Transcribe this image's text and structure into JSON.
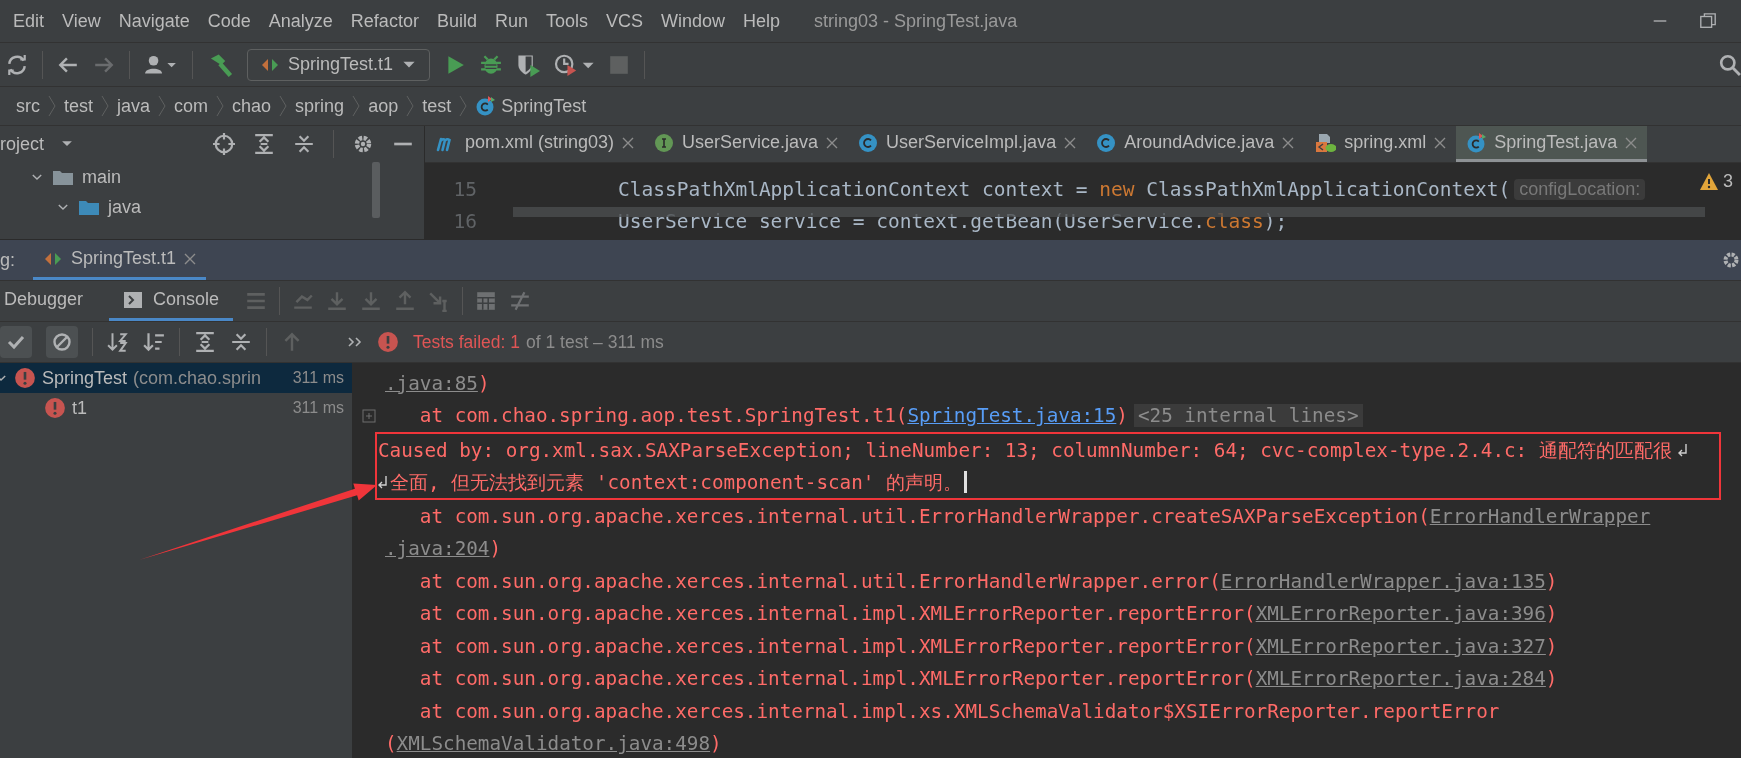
{
  "menu": [
    "Edit",
    "View",
    "Navigate",
    "Code",
    "Analyze",
    "Refactor",
    "Build",
    "Run",
    "Tools",
    "VCS",
    "Window",
    "Help"
  ],
  "window_title": "string03 - SpringTest.java",
  "run_config": "SpringTest.t1",
  "breadcrumbs": [
    {
      "label": "src",
      "kind": "plain"
    },
    {
      "label": "test",
      "kind": "plain"
    },
    {
      "label": "java",
      "kind": "plain"
    },
    {
      "label": "com",
      "kind": "plain"
    },
    {
      "label": "chao",
      "kind": "plain"
    },
    {
      "label": "spring",
      "kind": "plain"
    },
    {
      "label": "aop",
      "kind": "plain"
    },
    {
      "label": "test",
      "kind": "plain"
    },
    {
      "label": "SpringTest",
      "kind": "test_class"
    }
  ],
  "project_pane": {
    "title": "roject",
    "tree": [
      {
        "label": "main",
        "kind": "folder",
        "expanded": true,
        "children": [
          {
            "label": "java",
            "kind": "source_folder",
            "expanded": true
          }
        ]
      }
    ]
  },
  "editor_tabs": [
    {
      "label": "pom.xml (string03)",
      "kind": "maven",
      "selected": false
    },
    {
      "label": "UserService.java",
      "kind": "interface",
      "selected": false
    },
    {
      "label": "UserServiceImpl.java",
      "kind": "class",
      "selected": false
    },
    {
      "label": "AroundAdvice.java",
      "kind": "class",
      "selected": false
    },
    {
      "label": "spring.xml",
      "kind": "xml",
      "selected": false
    },
    {
      "label": "SpringTest.java",
      "kind": "test_class",
      "selected": true
    }
  ],
  "editor": {
    "warnings": "3",
    "lines": [
      {
        "number": "15",
        "tokens": [
          {
            "kind": "plain",
            "text": "ClassPathXmlApplicationContext context = "
          },
          {
            "kind": "keyword",
            "text": "new"
          },
          {
            "kind": "plain",
            "text": " ClassPathXmlApplicationContext("
          },
          {
            "kind": "hint",
            "text": "configLocation:"
          }
        ]
      },
      {
        "number": "16",
        "tokens": [
          {
            "kind": "plain",
            "text": "UserService service = context.getBean(UserService."
          },
          {
            "kind": "keyword",
            "text": "class"
          },
          {
            "kind": "plain",
            "text": ");"
          }
        ]
      }
    ]
  },
  "debug": {
    "label": "g:",
    "tabs": [
      {
        "label": "SpringTest.t1",
        "selected": true
      }
    ],
    "subtabs": [
      {
        "label": "Debugger",
        "selected": false
      },
      {
        "label": "Console",
        "selected": true
      }
    ]
  },
  "test_status": {
    "failed": "Tests failed: 1",
    "summary": "of 1 test – 311 ms"
  },
  "test_tree": [
    {
      "name": "SpringTest",
      "detail": "(com.chao.sprin",
      "time": "311 ms",
      "selected": true,
      "expanded": true,
      "children": [
        {
          "name": "t1",
          "time": "311 ms",
          "selected": false
        }
      ]
    }
  ],
  "console": [
    {
      "parts": [
        {
          "kind": "link",
          "text": ".java:85"
        },
        {
          "kind": "text",
          "text": ")"
        }
      ]
    },
    {
      "parts": [
        {
          "kind": "text",
          "text": "   at com.chao.spring.aop.test.SpringTest.t1("
        },
        {
          "kind": "source_link",
          "text": "SpringTest.java:15"
        },
        {
          "kind": "text",
          "text": ")"
        }
      ],
      "fold": "<25 internal lines>"
    },
    {
      "highlighted": true,
      "wrap_end": true,
      "parts": [
        {
          "kind": "text",
          "text": "Caused by: org.xml.sax.SAXParseException; lineNumber: 13; columnNumber: 64; cvc-complex-type.2.4.c: 通配符的匹配很"
        }
      ]
    },
    {
      "highlighted": true,
      "wrap_start": true,
      "cursor": true,
      "parts": [
        {
          "kind": "text",
          "text": "全面, 但无法找到元素 'context:component-scan' 的声明。"
        }
      ]
    },
    {
      "parts": [
        {
          "kind": "text",
          "text": "   at com.sun.org.apache.xerces.internal.util.ErrorHandlerWrapper.createSAXParseException("
        },
        {
          "kind": "link",
          "text": "ErrorHandlerWrapper"
        }
      ]
    },
    {
      "parts": [
        {
          "kind": "link",
          "text": ".java:204"
        },
        {
          "kind": "text",
          "text": ")"
        }
      ]
    },
    {
      "parts": [
        {
          "kind": "text",
          "text": "   at com.sun.org.apache.xerces.internal.util.ErrorHandlerWrapper.error("
        },
        {
          "kind": "link",
          "text": "ErrorHandlerWrapper.java:135"
        },
        {
          "kind": "text",
          "text": ")"
        }
      ]
    },
    {
      "parts": [
        {
          "kind": "text",
          "text": "   at com.sun.org.apache.xerces.internal.impl.XMLErrorReporter.reportError("
        },
        {
          "kind": "link",
          "text": "XMLErrorReporter.java:396"
        },
        {
          "kind": "text",
          "text": ")"
        }
      ]
    },
    {
      "parts": [
        {
          "kind": "text",
          "text": "   at com.sun.org.apache.xerces.internal.impl.XMLErrorReporter.reportError("
        },
        {
          "kind": "link",
          "text": "XMLErrorReporter.java:327"
        },
        {
          "kind": "text",
          "text": ")"
        }
      ]
    },
    {
      "parts": [
        {
          "kind": "text",
          "text": "   at com.sun.org.apache.xerces.internal.impl.XMLErrorReporter.reportError("
        },
        {
          "kind": "link",
          "text": "XMLErrorReporter.java:284"
        },
        {
          "kind": "text",
          "text": ")"
        }
      ]
    },
    {
      "parts": [
        {
          "kind": "text",
          "text": "   at com.sun.org.apache.xerces.internal.impl.xs.XMLSchemaValidator$XSIErrorReporter.reportError"
        }
      ]
    },
    {
      "parts": [
        {
          "kind": "text",
          "text": "("
        },
        {
          "kind": "link",
          "text": "XMLSchemaValidator.java:498"
        },
        {
          "kind": "text",
          "text": ")"
        }
      ]
    }
  ]
}
